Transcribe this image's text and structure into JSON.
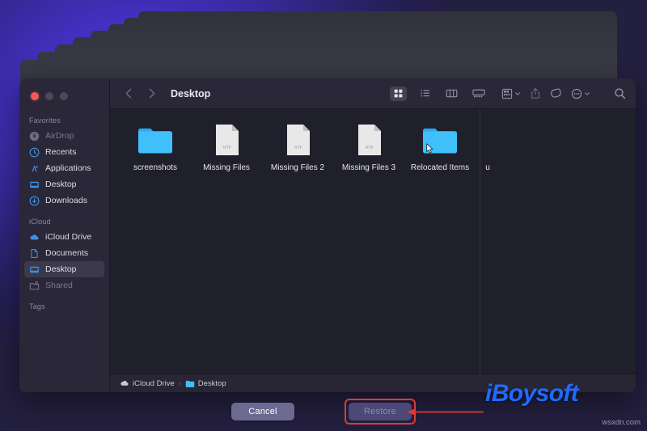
{
  "window": {
    "title": "Desktop",
    "traffic_lights": [
      "close",
      "minimize",
      "zoom"
    ]
  },
  "toolbar": {
    "back_icon": "chevron-left-icon",
    "forward_icon": "chevron-right-icon",
    "view_modes": [
      {
        "name": "icon-view",
        "icon": "grid-icon",
        "active": true
      },
      {
        "name": "list-view",
        "icon": "list-icon",
        "active": false
      },
      {
        "name": "column-view",
        "icon": "columns-icon",
        "active": false
      },
      {
        "name": "gallery-view",
        "icon": "gallery-icon",
        "active": false
      }
    ],
    "actions": [
      {
        "name": "group-by",
        "icon": "group-icon",
        "has_chevron": true
      },
      {
        "name": "share",
        "icon": "share-icon",
        "has_chevron": false
      },
      {
        "name": "tag",
        "icon": "tag-icon",
        "has_chevron": false
      },
      {
        "name": "more",
        "icon": "ellipsis-circle-icon",
        "has_chevron": true
      },
      {
        "name": "search",
        "icon": "search-icon",
        "has_chevron": false
      }
    ]
  },
  "sidebar": {
    "sections": [
      {
        "label": "Favorites",
        "items": [
          {
            "label": "AirDrop",
            "icon": "airdrop-icon",
            "selected": false,
            "muted": true
          },
          {
            "label": "Recents",
            "icon": "clock-icon",
            "selected": false,
            "muted": false
          },
          {
            "label": "Applications",
            "icon": "applications-icon",
            "selected": false,
            "muted": false
          },
          {
            "label": "Desktop",
            "icon": "desktop-icon",
            "selected": false,
            "muted": false
          },
          {
            "label": "Downloads",
            "icon": "download-icon",
            "selected": false,
            "muted": false
          }
        ]
      },
      {
        "label": "iCloud",
        "items": [
          {
            "label": "iCloud Drive",
            "icon": "cloud-icon",
            "selected": false,
            "muted": false
          },
          {
            "label": "Documents",
            "icon": "document-icon",
            "selected": false,
            "muted": false
          },
          {
            "label": "Desktop",
            "icon": "desktop-icon",
            "selected": true,
            "muted": false
          },
          {
            "label": "Shared",
            "icon": "shared-folder-icon",
            "selected": false,
            "muted": true
          }
        ]
      },
      {
        "label": "Tags",
        "items": []
      }
    ]
  },
  "files": [
    {
      "label": "screenshots",
      "type": "folder",
      "badge": ""
    },
    {
      "label": "Missing Files",
      "type": "document",
      "badge": "RTF"
    },
    {
      "label": "Missing Files 2",
      "type": "document",
      "badge": "RTF"
    },
    {
      "label": "Missing Files 3",
      "type": "document",
      "badge": "RTF"
    },
    {
      "label": "Relocated Items",
      "type": "folder",
      "badge": ""
    },
    {
      "label": "u",
      "type": "clipped",
      "badge": ""
    }
  ],
  "pathbar": {
    "segments": [
      {
        "label": "iCloud Drive",
        "icon": "cloud-icon"
      },
      {
        "label": "Desktop",
        "icon": "folder-icon"
      }
    ],
    "separator": "›"
  },
  "actions": {
    "cancel_label": "Cancel",
    "restore_label": "Restore",
    "restore_enabled": false,
    "annotation": "red-highlight-box-and-arrow"
  },
  "watermarks": {
    "brand": "iBoysoft",
    "site": "wsxdn.com"
  },
  "colors": {
    "accent_blue": "#1f6bff",
    "annotation_red": "#e03a32",
    "folder_blue": "#35b4f7",
    "window_chrome": "#2a2738",
    "content_bg": "#201f2c",
    "desktop_purple": "#4730c8"
  }
}
